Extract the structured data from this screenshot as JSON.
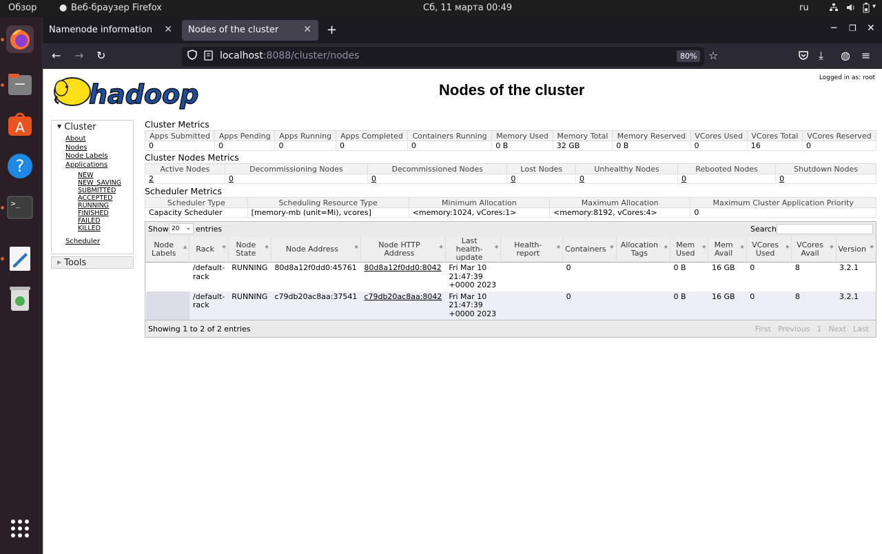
{
  "system": {
    "overview": "Обзор",
    "app": "Веб-браузер Firefox",
    "clock": "Сб, 11 марта  00:49",
    "lang": "ru"
  },
  "browser": {
    "tabs": [
      {
        "label": "Namenode information"
      },
      {
        "label": "Nodes of the cluster"
      }
    ],
    "url_host": "localhost",
    "url_path": ":8088/cluster/nodes",
    "zoom": "80%"
  },
  "page": {
    "title": "Nodes of the cluster",
    "logged_in": "Logged in as: root",
    "logo_text": "hadoop"
  },
  "sidebar": {
    "cluster_label": "Cluster",
    "links": [
      "About",
      "Nodes",
      "Node Labels",
      "Applications"
    ],
    "app_states": [
      "NEW",
      "NEW_SAVING",
      "SUBMITTED",
      "ACCEPTED",
      "RUNNING",
      "FINISHED",
      "FAILED",
      "KILLED"
    ],
    "scheduler": "Scheduler",
    "tools_label": "Tools"
  },
  "cluster_metrics": {
    "title": "Cluster Metrics",
    "headers": [
      "Apps Submitted",
      "Apps Pending",
      "Apps Running",
      "Apps Completed",
      "Containers Running",
      "Memory Used",
      "Memory Total",
      "Memory Reserved",
      "VCores Used",
      "VCores Total",
      "VCores Reserved"
    ],
    "values": [
      "0",
      "0",
      "0",
      "0",
      "0",
      "0 B",
      "32 GB",
      "0 B",
      "0",
      "16",
      "0"
    ]
  },
  "nodes_metrics": {
    "title": "Cluster Nodes Metrics",
    "headers": [
      "Active Nodes",
      "Decommissioning Nodes",
      "Decommissioned Nodes",
      "Lost Nodes",
      "Unhealthy Nodes",
      "Rebooted Nodes",
      "Shutdown Nodes"
    ],
    "values": [
      "2",
      "0",
      "0",
      "0",
      "0",
      "0",
      "0"
    ]
  },
  "scheduler_metrics": {
    "title": "Scheduler Metrics",
    "headers": [
      "Scheduler Type",
      "Scheduling Resource Type",
      "Minimum Allocation",
      "Maximum Allocation",
      "Maximum Cluster Application Priority"
    ],
    "values": [
      "Capacity Scheduler",
      "[memory-mb (unit=Mi), vcores]",
      "<memory:1024, vCores:1>",
      "<memory:8192, vCores:4>",
      "0"
    ]
  },
  "datatable": {
    "show_label": "Show",
    "page_size": "20",
    "entries_label": "entries",
    "search_label": "Search:",
    "headers": [
      "Node Labels",
      "Rack",
      "Node State",
      "Node Address",
      "Node HTTP Address",
      "Last health-update",
      "Health-report",
      "Containers",
      "Allocation Tags",
      "Mem Used",
      "Mem Avail",
      "VCores Used",
      "VCores Avail",
      "Version"
    ],
    "rows": [
      [
        "",
        "/default-rack",
        "RUNNING",
        "80d8a12f0dd0:45761",
        "80d8a12f0dd0:8042",
        "Fri Mar 10 21:47:39 +0000 2023",
        "",
        "0",
        "",
        "0 B",
        "16 GB",
        "0",
        "8",
        "3.2.1"
      ],
      [
        "",
        "/default-rack",
        "RUNNING",
        "c79db20ac8aa:37541",
        "c79db20ac8aa:8042",
        "Fri Mar 10 21:47:39 +0000 2023",
        "",
        "0",
        "",
        "0 B",
        "16 GB",
        "0",
        "8",
        "3.2.1"
      ]
    ],
    "info": "Showing 1 to 2 of 2 entries",
    "pager": [
      "First",
      "Previous",
      "1",
      "Next",
      "Last"
    ]
  }
}
